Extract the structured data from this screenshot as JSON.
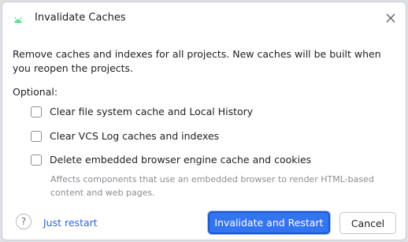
{
  "dialog": {
    "title": "Invalidate Caches",
    "description": "Remove caches and indexes for all projects. New caches will be built when you reopen the projects.",
    "optional_label": "Optional:",
    "options": [
      {
        "label": "Clear file system cache and Local History",
        "checked": false
      },
      {
        "label": "Clear VCS Log caches and indexes",
        "checked": false
      },
      {
        "label": "Delete embedded browser engine cache and cookies",
        "checked": false
      }
    ],
    "hint": "Affects components that use an embedded browser to render HTML-based content and web pages.",
    "help_icon_glyph": "?",
    "just_restart_label": "Just restart",
    "primary_button_label": "Invalidate and Restart",
    "cancel_button_label": "Cancel",
    "close_icon": "close-icon",
    "app_icon": "android-icon"
  },
  "colors": {
    "primary": "#3574f0",
    "link": "#2c63d9",
    "android_green": "#3ddc84",
    "hint_text": "#8a8d93"
  }
}
